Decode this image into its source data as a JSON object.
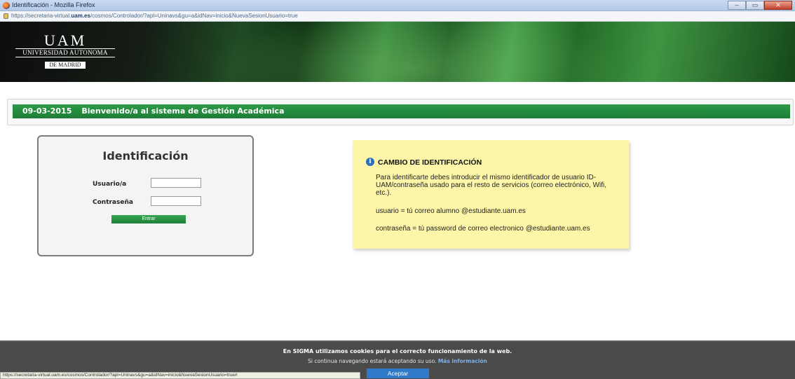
{
  "window": {
    "title": "Identificación - Mozilla Firefox",
    "url_prefix": "https://secretaria-virtual.",
    "url_domain": "uam.es",
    "url_path": "/cosmos/Controlador/?apl=Uninavs&gu=a&idNav=inicio&NuevaSesionUsuario=true",
    "buttons": {
      "minimize": "–",
      "maximize": "▭",
      "close": "✕"
    }
  },
  "logo": {
    "abbr": "UAM",
    "name": "UNIVERSIDAD AUTONOMA",
    "city": "DE MADRID"
  },
  "welcome": {
    "date": "09-03-2015",
    "message": "Bienvenido/a al sistema de Gestión Académica"
  },
  "login": {
    "title": "Identificación",
    "user_label": "Usuario/a",
    "user_value": "",
    "password_label": "Contraseña",
    "password_value": "",
    "submit_label": "Entrar"
  },
  "note": {
    "heading": "CAMBIO DE IDENTIFICACIÓN",
    "paragraph": "Para identificarte debes introducir el mismo identificador de usuario ID-UAM/contraseña usado para el resto de servicios (correo electrónico, Wifi, etc.).",
    "usuario": "usuario = tú correo alumno @estudiante.uam.es",
    "password": "contraseña = tú password de correo electronico @estudiante.uam.es"
  },
  "cookies": {
    "line1": "En SIGMA utilizamos cookies para el correcto funcionamiento de la web.",
    "line2": "Si continua navegando estará aceptando su uso.",
    "more_label": "Más información",
    "accept_label": "Aceptar"
  },
  "status_bar": {
    "text": "https://secretaria-virtual.uam.es/cosmos/Controlador/?apl=Uninavs&gu=a&idNav=inicio&NuevaSesionUsuario=true#"
  },
  "colors": {
    "accent_green": "#1d7d36",
    "note_yellow": "#fdf6a8",
    "accept_blue": "#2f79c8"
  }
}
